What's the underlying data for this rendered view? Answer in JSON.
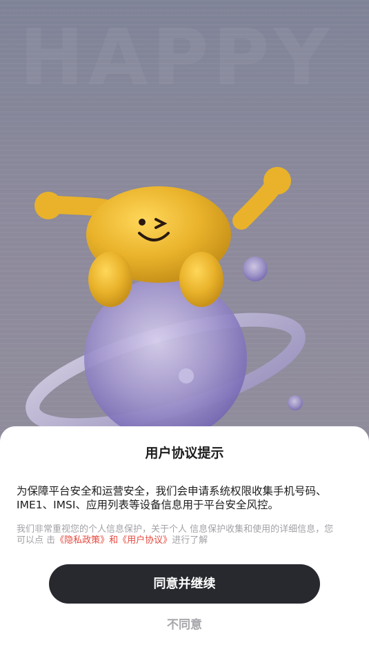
{
  "background": {
    "watermark_text": "HAPPY"
  },
  "dialog": {
    "title": "用户协议提示",
    "body": "为保障平台安全和运营安全，我们会申请系统权限收集手机号码、IME1、IMSI、应用列表等设备信息用于平台安全风控。",
    "note_prefix": "我们非常重视您的个人信息保护，关于个人 信息保护收集和使用的详细信息，您可以点 击",
    "privacy_link": "《隐私政策》",
    "link_joiner": "和",
    "terms_link": "《用户协议》",
    "note_suffix": "进行了解",
    "agree_button": "同意并继续",
    "disagree_button": "不同意"
  },
  "colors": {
    "primary_button": "#27292e",
    "link": "#e5473c",
    "muted_text": "#a2a2a7"
  },
  "icons": {
    "mascot": "smiling-yellow-bean-mascot-on-purple-planet"
  }
}
